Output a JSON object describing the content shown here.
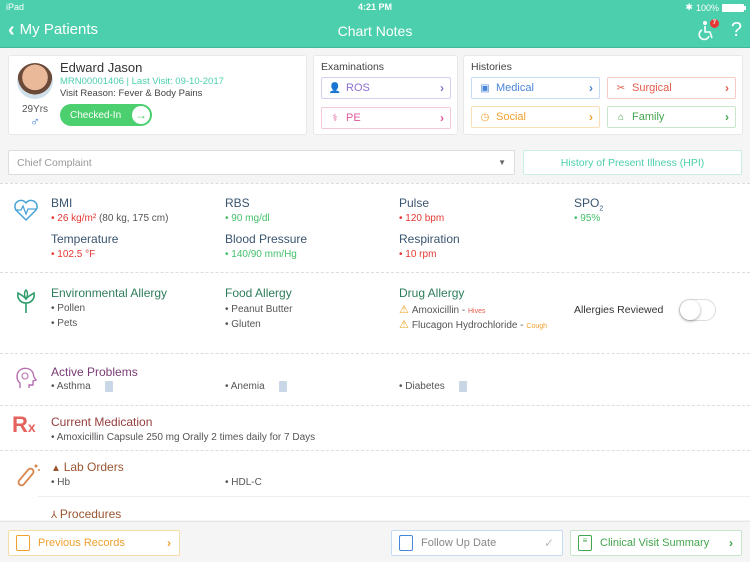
{
  "status_bar": {
    "device": "iPad",
    "time": "4:21 PM",
    "battery": "100%"
  },
  "nav": {
    "back_label": "My Patients",
    "title": "Chart Notes",
    "notification_count": "7",
    "help_label": "?"
  },
  "patient": {
    "name": "Edward Jason",
    "mrn_line": "MRN00001406 | Last Visit: 09-10-2017",
    "visit_reason_label": "Visit Reason:",
    "visit_reason": "Fever & Body Pains",
    "age": "29Yrs",
    "gender_symbol": "♂",
    "status_button": "Checked-In"
  },
  "examinations": {
    "title": "Examinations",
    "items": [
      {
        "label": "ROS",
        "color": "#8c6fd1"
      },
      {
        "label": "PE",
        "color": "#e0599b"
      }
    ]
  },
  "histories": {
    "title": "Histories",
    "items": [
      {
        "label": "Medical",
        "color": "#4a86d8"
      },
      {
        "label": "Surgical",
        "color": "#e55b4b"
      },
      {
        "label": "Social",
        "color": "#f0a030"
      },
      {
        "label": "Family",
        "color": "#43a64e"
      }
    ]
  },
  "chief_complaint": {
    "placeholder": "Chief Complaint"
  },
  "hpi_button": "History of Present Illness (HPI)",
  "vitals": [
    {
      "label": "BMI",
      "value": "26 kg/m²",
      "extra": " (80 kg, 175 cm)",
      "status": "red"
    },
    {
      "label": "RBS",
      "value": "90 mg/dl",
      "status": "green"
    },
    {
      "label": "Pulse",
      "value": "120 bpm",
      "status": "red"
    },
    {
      "label": "SPO",
      "label_sub": "2",
      "value": "95%",
      "status": "green"
    },
    {
      "label": "Temperature",
      "value": "102.5 °F",
      "status": "red"
    },
    {
      "label": "Blood Pressure",
      "value": "140/90 mm/Hg",
      "status": "green"
    },
    {
      "label": "Respiration",
      "value": "10 rpm",
      "status": "red"
    }
  ],
  "allergies": {
    "environmental": {
      "title": "Environmental Allergy",
      "items": [
        "Pollen",
        "Pets"
      ]
    },
    "food": {
      "title": "Food Allergy",
      "items": [
        "Peanut Butter",
        "Gluten"
      ]
    },
    "drug": {
      "title": "Drug Allergy",
      "items": [
        {
          "name": "Amoxicillin",
          "reaction": "Hives",
          "reaction_color": "#e55b4b"
        },
        {
          "name": "Flucagon Hydrochloride",
          "reaction": "Cough",
          "reaction_color": "#f0a030"
        }
      ]
    },
    "reviewed_label": "Allergies Reviewed",
    "reviewed": false
  },
  "active_problems": {
    "title": "Active Problems",
    "items": [
      "Asthma",
      "Anemia",
      "Diabetes"
    ]
  },
  "current_medication": {
    "title": "Current Medication",
    "items": [
      "Amoxicillin Capsule 250 mg Orally 2 times daily for 7 Days"
    ]
  },
  "lab_orders": {
    "title": "Lab Orders",
    "items": [
      "Hb",
      "HDL-C"
    ]
  },
  "procedures": {
    "title": "Procedures"
  },
  "footer": {
    "previous_records": "Previous Records",
    "follow_up_placeholder": "Follow Up Date",
    "clinical_visit_summary": "Clinical Visit Summary"
  }
}
